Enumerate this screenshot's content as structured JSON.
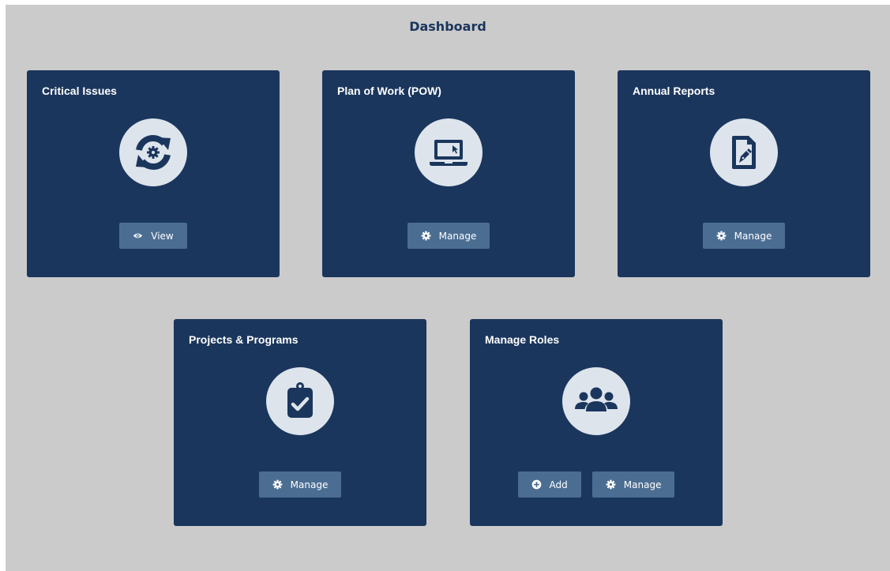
{
  "page": {
    "title": "Dashboard"
  },
  "colors": {
    "background": "#cbcbcb",
    "card": "#1b365d",
    "button": "#4b6d92",
    "icon_circle": "#dde4ec",
    "title_text": "#1b365d"
  },
  "cards": [
    {
      "title": "Critical Issues",
      "icon": "sync-gear-icon",
      "buttons": [
        {
          "label": "View",
          "icon": "eye-icon"
        }
      ]
    },
    {
      "title": "Plan of Work (POW)",
      "icon": "laptop-icon",
      "buttons": [
        {
          "label": "Manage",
          "icon": "gear-icon"
        }
      ]
    },
    {
      "title": "Annual Reports",
      "icon": "file-signature-icon",
      "buttons": [
        {
          "label": "Manage",
          "icon": "gear-icon"
        }
      ]
    },
    {
      "title": "Projects & Programs",
      "icon": "clipboard-check-icon",
      "buttons": [
        {
          "label": "Manage",
          "icon": "gear-icon"
        }
      ]
    },
    {
      "title": "Manage Roles",
      "icon": "users-icon",
      "buttons": [
        {
          "label": "Add",
          "icon": "plus-circle-icon"
        },
        {
          "label": "Manage",
          "icon": "gear-icon"
        }
      ]
    }
  ]
}
